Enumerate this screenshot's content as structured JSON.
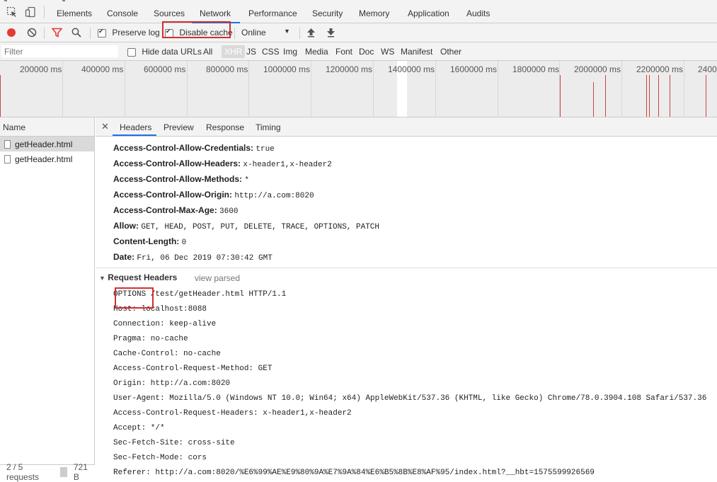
{
  "devtools_tabs": [
    "Elements",
    "Console",
    "Sources",
    "Network",
    "Performance",
    "Security",
    "Memory",
    "Application",
    "Audits"
  ],
  "active_tab": "Network",
  "toolbar": {
    "preserve_log": "Preserve log",
    "preserve_log_checked": true,
    "disable_cache": "Disable cache",
    "disable_cache_checked": true,
    "throttling": "Online"
  },
  "filter": {
    "placeholder": "Filter",
    "hide_data_urls": "Hide data URLs",
    "types": [
      "All",
      "XHR",
      "JS",
      "CSS",
      "Img",
      "Media",
      "Font",
      "Doc",
      "WS",
      "Manifest",
      "Other"
    ],
    "active_type": "XHR"
  },
  "timeline": {
    "labels": [
      "200000 ms",
      "400000 ms",
      "600000 ms",
      "800000 ms",
      "1000000 ms",
      "1200000 ms",
      "1400000 ms",
      "1600000 ms",
      "1800000 ms",
      "2000000 ms",
      "2200000 ms",
      "2400"
    ]
  },
  "name_pane": {
    "header": "Name",
    "rows": [
      "getHeader.html",
      "getHeader.html"
    ],
    "status_requests": "2 / 5 requests",
    "status_size": "721 B"
  },
  "detail_tabs": [
    "Headers",
    "Preview",
    "Response",
    "Timing"
  ],
  "response_headers": [
    {
      "name": "Access-Control-Allow-Credentials:",
      "value": "true"
    },
    {
      "name": "Access-Control-Allow-Headers:",
      "value": "x-header1,x-header2"
    },
    {
      "name": "Access-Control-Allow-Methods:",
      "value": "*"
    },
    {
      "name": "Access-Control-Allow-Origin:",
      "value": "http://a.com:8020"
    },
    {
      "name": "Access-Control-Max-Age:",
      "value": "3600"
    },
    {
      "name": "Allow:",
      "value": "GET, HEAD, POST, PUT, DELETE, TRACE, OPTIONS, PATCH"
    },
    {
      "name": "Content-Length:",
      "value": "0"
    },
    {
      "name": "Date:",
      "value": "Fri, 06 Dec 2019 07:30:42 GMT"
    }
  ],
  "request_headers": {
    "title": "Request Headers",
    "view_parsed": "view parsed",
    "lines": [
      "OPTIONS /test/getHeader.html HTTP/1.1",
      "Host: localhost:8088",
      "Connection: keep-alive",
      "Pragma: no-cache",
      "Cache-Control: no-cache",
      "Access-Control-Request-Method: GET",
      "Origin: http://a.com:8020",
      "User-Agent: Mozilla/5.0 (Windows NT 10.0; Win64; x64) AppleWebKit/537.36 (KHTML, like Gecko) Chrome/78.0.3904.108 Safari/537.36",
      "Access-Control-Request-Headers: x-header1,x-header2",
      "Accept: */*",
      "Sec-Fetch-Site: cross-site",
      "Sec-Fetch-Mode: cors",
      "Referer: http://a.com:8020/%E6%99%AE%E9%80%9A%E7%9A%84%E6%B5%8B%E8%AF%95/index.html?__hbt=1575599926569"
    ]
  },
  "colors": {
    "accent": "#1a73e8",
    "record": "#e53935",
    "highlight": "#d32f2f",
    "filter_icon": "#e53935"
  }
}
